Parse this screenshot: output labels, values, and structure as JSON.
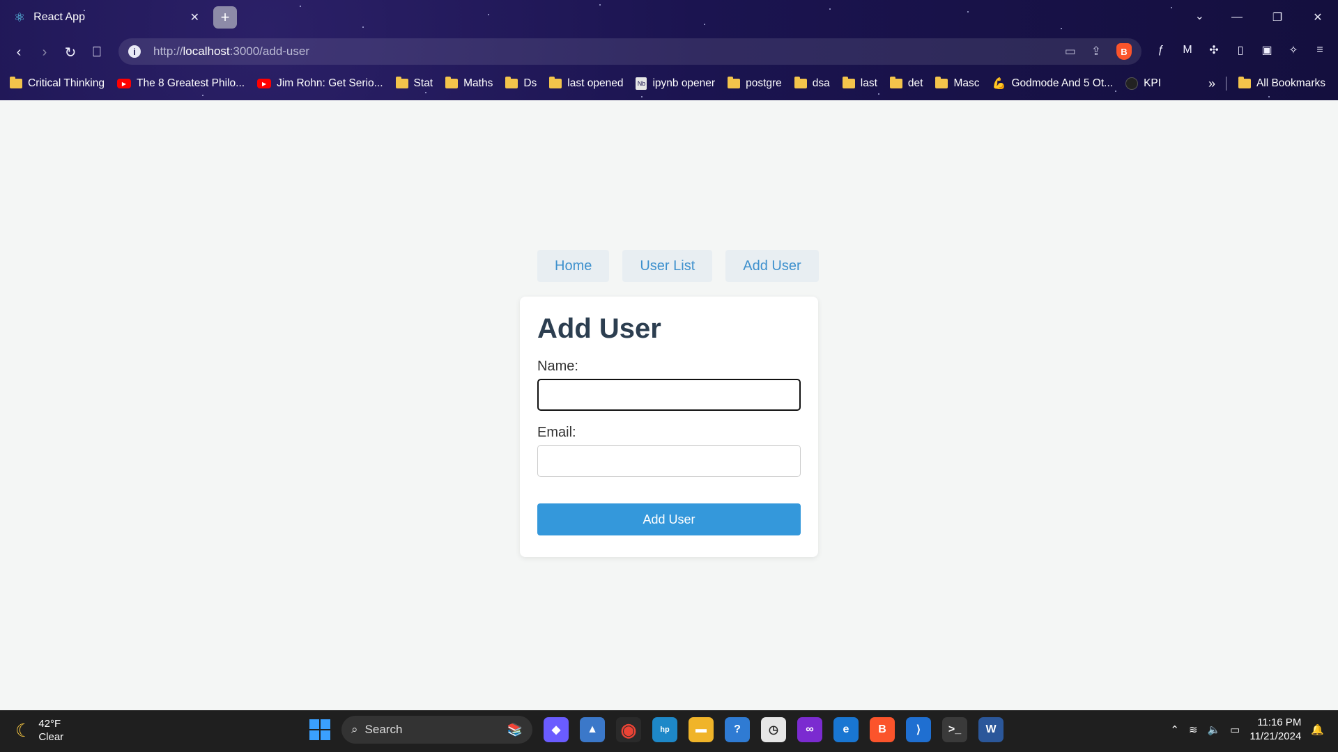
{
  "browser": {
    "tab_title": "React App",
    "url_scheme": "http://",
    "url_host": "localhost",
    "url_path": ":3000/add-user",
    "bookmarks": [
      {
        "label": "Critical Thinking",
        "icon": "folder-icon"
      },
      {
        "label": "The 8 Greatest Philo...",
        "icon": "youtube-icon"
      },
      {
        "label": "Jim Rohn: Get Serio...",
        "icon": "youtube-icon"
      },
      {
        "label": "Stat",
        "icon": "folder-icon"
      },
      {
        "label": "Maths",
        "icon": "folder-icon"
      },
      {
        "label": "Ds",
        "icon": "folder-icon"
      },
      {
        "label": "last opened",
        "icon": "folder-icon"
      },
      {
        "label": "ipynb opener",
        "icon": "notebook-icon"
      },
      {
        "label": "postgre",
        "icon": "folder-icon"
      },
      {
        "label": "dsa",
        "icon": "folder-icon"
      },
      {
        "label": "last",
        "icon": "folder-icon"
      },
      {
        "label": "det",
        "icon": "folder-icon"
      },
      {
        "label": "Masc",
        "icon": "folder-icon"
      },
      {
        "label": "Godmode And 5 Ot...",
        "icon": "godmode-icon"
      },
      {
        "label": "KPI",
        "icon": "github-icon"
      }
    ],
    "all_bookmarks": "All Bookmarks"
  },
  "page": {
    "nav": {
      "home": "Home",
      "user_list": "User List",
      "add_user": "Add User"
    },
    "form": {
      "title": "Add User",
      "name_label": "Name:",
      "name_value": "",
      "email_label": "Email:",
      "email_value": "",
      "submit_label": "Add User"
    }
  },
  "taskbar": {
    "weather_temp": "42°F",
    "weather_desc": "Clear",
    "search_label": "Search",
    "time": "11:16 PM",
    "date": "11/21/2024"
  },
  "colors": {
    "accent": "#3498db",
    "nav_link": "#3d90cd",
    "heading": "#2c3e50"
  }
}
